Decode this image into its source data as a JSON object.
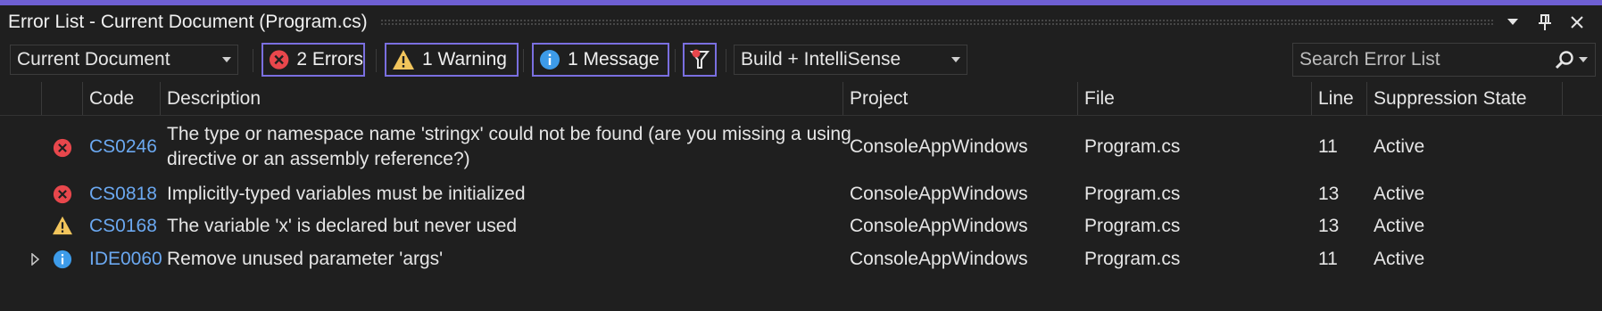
{
  "window": {
    "title": "Error List - Current Document (Program.cs)",
    "accent": "#6e5fd3"
  },
  "title_actions": [
    "dropdown-icon",
    "pin-icon",
    "close-icon"
  ],
  "toolbar": {
    "scope_select": "Current Document",
    "errors_label": "2 Errors",
    "warnings_label": "1 Warning",
    "messages_label": "1 Message",
    "filter_icon": "filter-icon",
    "source_select": "Build + IntelliSense",
    "search_placeholder": "Search Error List"
  },
  "columns": {
    "code": "Code",
    "description": "Description",
    "project": "Project",
    "file": "File",
    "line": "Line",
    "suppression": "Suppression State"
  },
  "rows": [
    {
      "severity": "error",
      "code": "CS0246",
      "description": "The type or namespace name 'stringx' could not be found (are you missing a using directive or an assembly reference?)",
      "project": "ConsoleAppWindows",
      "file": "Program.cs",
      "line": "11",
      "suppression": "Active"
    },
    {
      "severity": "error",
      "code": "CS0818",
      "description": "Implicitly-typed variables must be initialized",
      "project": "ConsoleAppWindows",
      "file": "Program.cs",
      "line": "13",
      "suppression": "Active"
    },
    {
      "severity": "warning",
      "code": "CS0168",
      "description": "The variable 'x' is declared but never used",
      "project": "ConsoleAppWindows",
      "file": "Program.cs",
      "line": "13",
      "suppression": "Active"
    },
    {
      "severity": "info",
      "code": "IDE0060",
      "description": "Remove unused parameter 'args'",
      "project": "ConsoleAppWindows",
      "file": "Program.cs",
      "line": "11",
      "suppression": "Active"
    }
  ],
  "colors": {
    "error": "#e8474c",
    "warning": "#f2c55c",
    "info": "#3d9be9",
    "link": "#6ba8f0",
    "filter_border": "#7a6fe0"
  }
}
